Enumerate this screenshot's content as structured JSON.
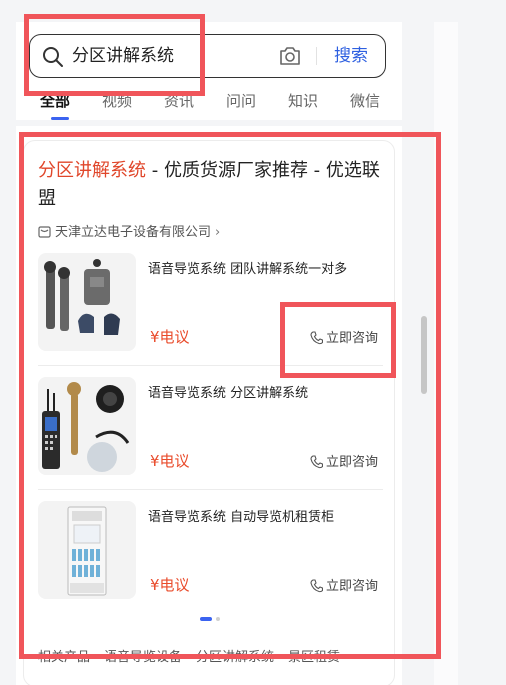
{
  "search": {
    "query": "分区讲解系统",
    "button_label": "搜索"
  },
  "tabs": [
    {
      "label": "全部",
      "active": true
    },
    {
      "label": "视频"
    },
    {
      "label": "资讯"
    },
    {
      "label": "问问"
    },
    {
      "label": "知识"
    },
    {
      "label": "微信"
    }
  ],
  "ad": {
    "title_highlight": "分区讲解系统",
    "title_rest": " - 优质货源厂家推荐 - 优选联盟",
    "seller": "天津立达电子设备有限公司",
    "products": [
      {
        "name": "语音导览系统 团队讲解系统一对多",
        "price": "¥电议",
        "consult_label": "立即咨询"
      },
      {
        "name": "语音导览系统 分区讲解系统",
        "price": "¥电议",
        "consult_label": "立即咨询"
      },
      {
        "name": "语音导览系统 自动导览机租赁柜",
        "price": "¥电议",
        "consult_label": "立即咨询"
      }
    ],
    "related": [
      "相关产品",
      "语音导览设备",
      "分区讲解系统",
      "景区租赁"
    ]
  },
  "colors": {
    "accent_blue": "#2d5fe0",
    "price_red": "#e94b2b",
    "annotation_red": "#f0555a"
  }
}
